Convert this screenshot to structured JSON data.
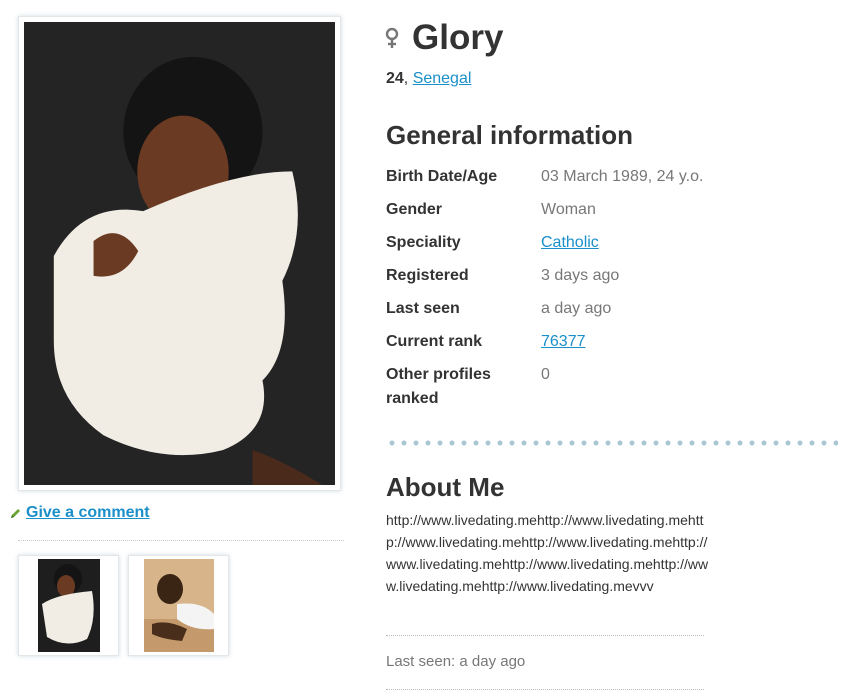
{
  "profile": {
    "name": "Glory",
    "age": "24",
    "age_separator": ", ",
    "country": "Senegal",
    "gender_icon": "female-symbol-icon"
  },
  "left": {
    "comment_label": "Give a comment",
    "comment_icon": "pencil-icon"
  },
  "general": {
    "heading": "General information",
    "rows": [
      {
        "label": "Birth Date/Age",
        "value": "03 March 1989, 24 y.o."
      },
      {
        "label": "Gender",
        "value": "Woman"
      },
      {
        "label": "Speciality",
        "value": "Catholic"
      },
      {
        "label": "Registered",
        "value": "3 days ago"
      },
      {
        "label": "Last seen",
        "value": "a day ago"
      },
      {
        "label": "Current rank",
        "value": "76377"
      },
      {
        "label": "Other profiles ranked",
        "value": "0"
      }
    ]
  },
  "about": {
    "heading": "About Me",
    "text": "http://www.livedating.mehttp://www.livedating.mehttp://www.livedating.mehttp://www.livedating.mehttp://www.livedating.mehttp://www.livedating.mehttp://www.livedating.mehttp://www.livedating.mevvv"
  },
  "footer": {
    "last_seen": "Last seen: a day ago"
  },
  "colors": {
    "link": "#1a8fc9",
    "muted_text": "#777777",
    "heading_text": "#333333",
    "dot_divider": "#a9c6d3"
  }
}
